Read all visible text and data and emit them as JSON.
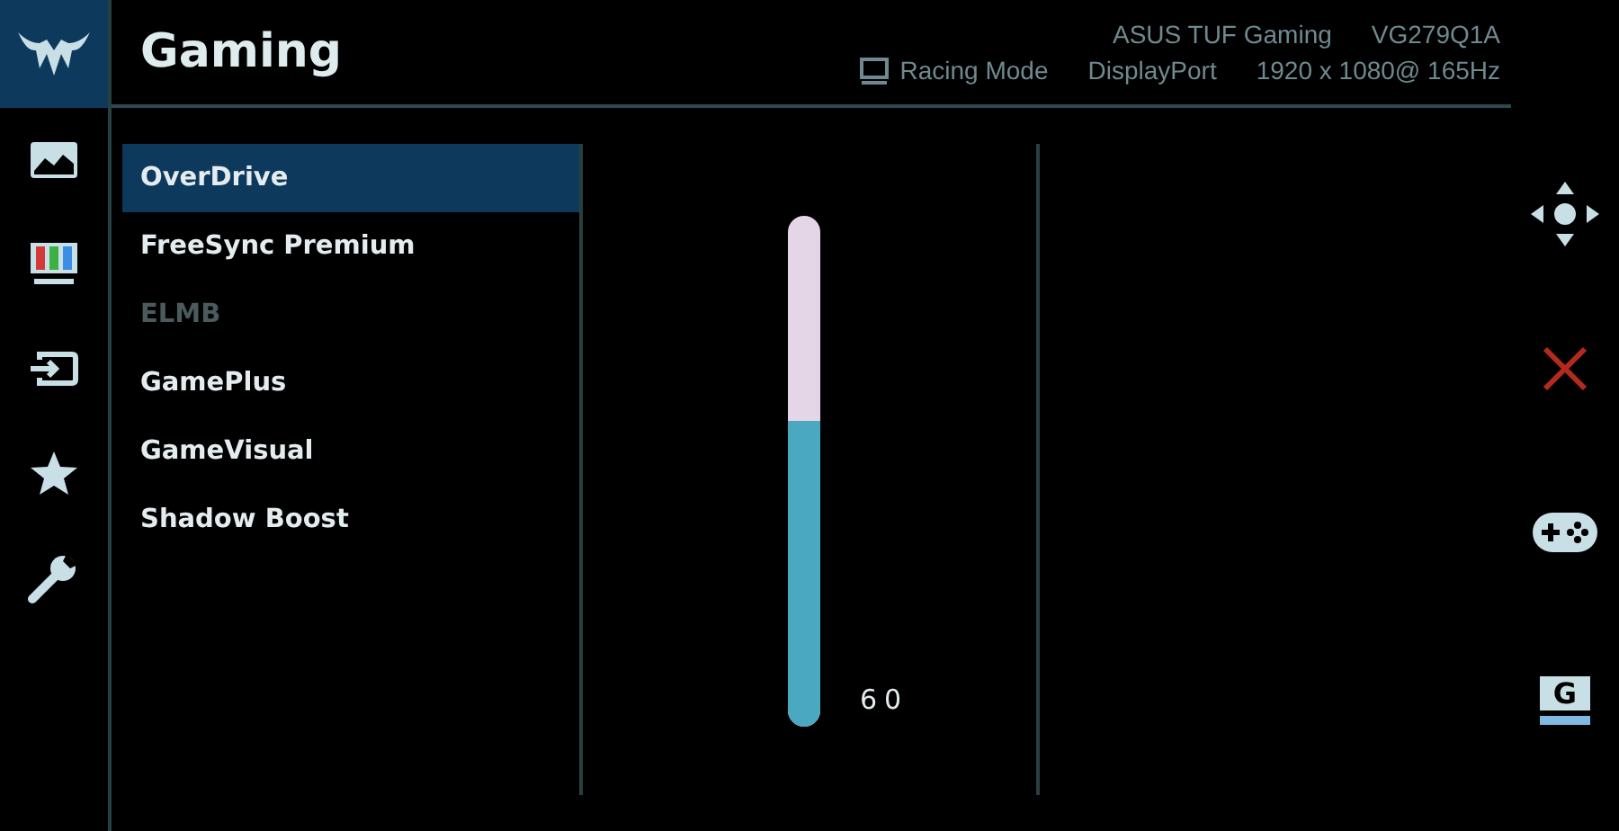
{
  "sidebar": {
    "items": [
      {
        "kind": "logo",
        "selected": true
      },
      {
        "kind": "picture",
        "selected": false
      },
      {
        "kind": "color",
        "selected": false
      },
      {
        "kind": "input",
        "selected": false
      },
      {
        "kind": "star",
        "selected": false
      },
      {
        "kind": "wrench",
        "selected": false
      }
    ]
  },
  "header": {
    "title": "Gaming",
    "model_name": "ASUS TUF Gaming",
    "model_number": "VG279Q1A",
    "mode": "Racing Mode",
    "input": "DisplayPort",
    "resolution": "1920 x 1080@ 165Hz"
  },
  "menu": {
    "items": [
      {
        "label": "OverDrive",
        "selected": true,
        "disabled": false
      },
      {
        "label": "FreeSync Premium",
        "selected": false,
        "disabled": false
      },
      {
        "label": "ELMB",
        "selected": false,
        "disabled": true
      },
      {
        "label": "GamePlus",
        "selected": false,
        "disabled": false
      },
      {
        "label": "GameVisual",
        "selected": false,
        "disabled": false
      },
      {
        "label": "Shadow Boost",
        "selected": false,
        "disabled": false
      }
    ]
  },
  "slider": {
    "level": 0.6,
    "reading": "60"
  },
  "keys": [
    {
      "kind": "navigate"
    },
    {
      "kind": "close"
    },
    {
      "kind": "gamepad"
    },
    {
      "kind": "hotkey",
      "label": "G"
    }
  ]
}
